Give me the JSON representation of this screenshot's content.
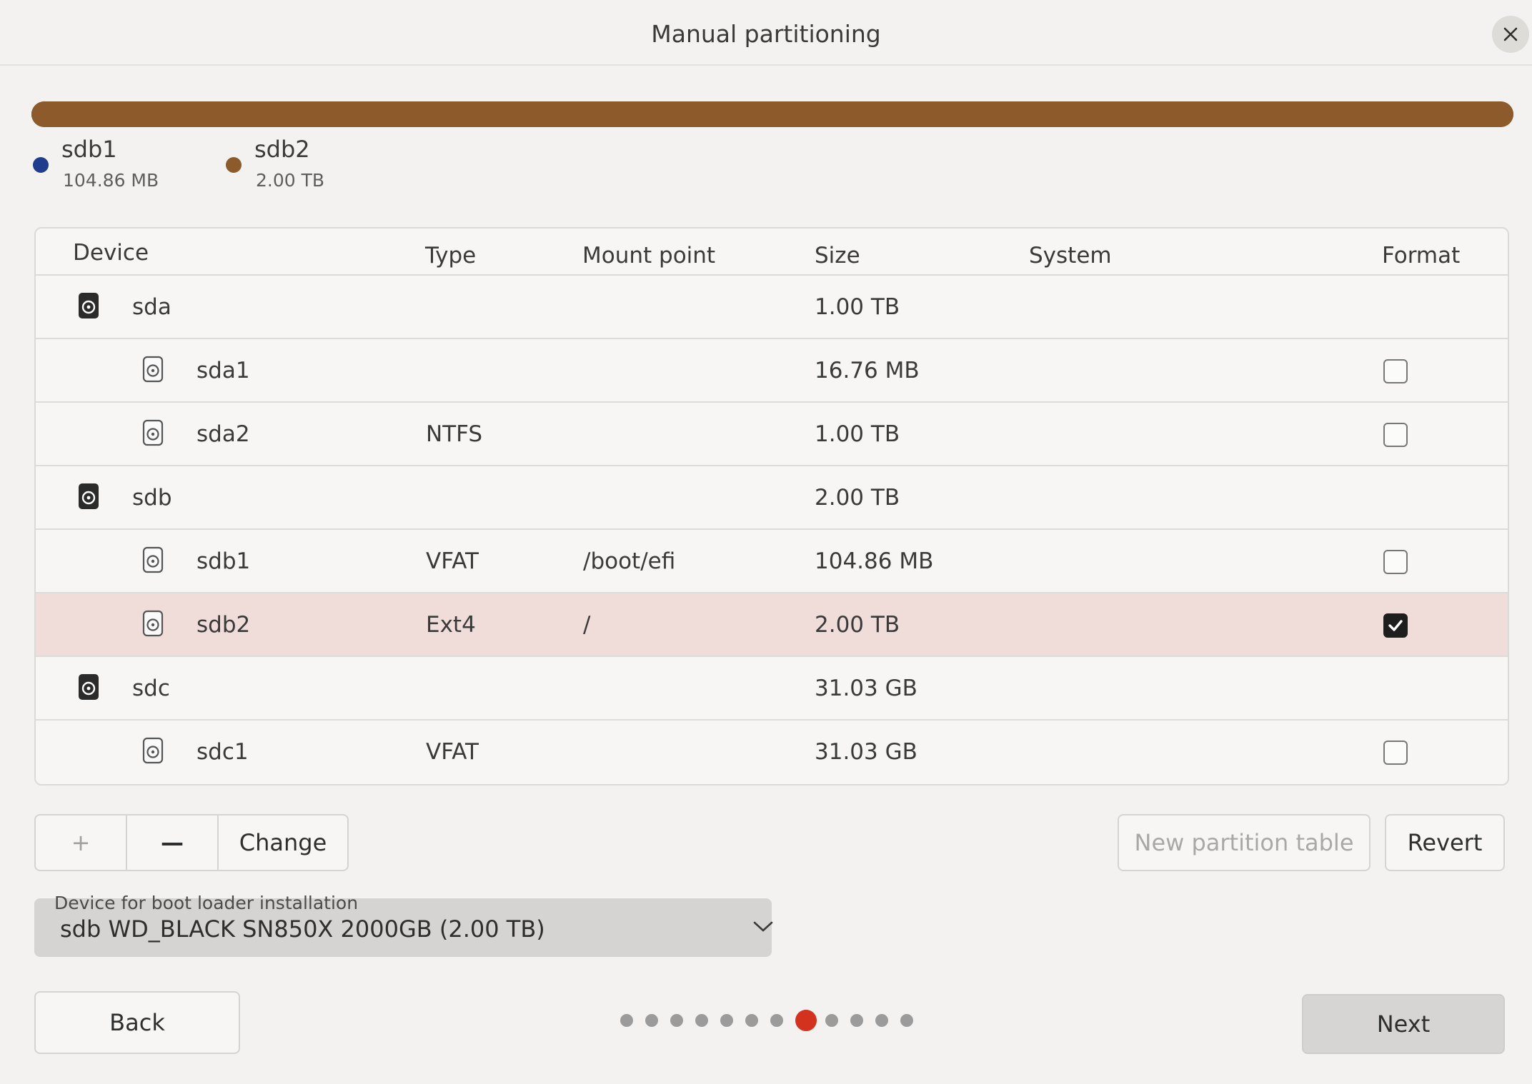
{
  "window": {
    "title": "Manual partitioning",
    "close_icon": "close-icon"
  },
  "usage_bar": {
    "segments": [
      {
        "name": "sdb1",
        "fraction": 0.0001,
        "color": "#203c8c"
      },
      {
        "name": "sdb2",
        "fraction": 0.9999,
        "color": "#8c5a2b"
      }
    ]
  },
  "legend": [
    {
      "name": "sdb1",
      "size": "104.86 MB",
      "color": "#203c8c"
    },
    {
      "name": "sdb2",
      "size": "2.00 TB",
      "color": "#8c5a2b"
    }
  ],
  "table": {
    "headers": {
      "device": "Device",
      "type": "Type",
      "mount": "Mount point",
      "size": "Size",
      "system": "System",
      "format": "Format"
    },
    "rows": [
      {
        "device": "sda",
        "kind": "disk",
        "type": "",
        "mount": "",
        "size": "1.00 TB",
        "system": "",
        "format": null,
        "selected": false
      },
      {
        "device": "sda1",
        "kind": "partition",
        "type": "",
        "mount": "",
        "size": "16.76 MB",
        "system": "",
        "format": false,
        "selected": false
      },
      {
        "device": "sda2",
        "kind": "partition",
        "type": "NTFS",
        "mount": "",
        "size": "1.00 TB",
        "system": "",
        "format": false,
        "selected": false
      },
      {
        "device": "sdb",
        "kind": "disk",
        "type": "",
        "mount": "",
        "size": "2.00 TB",
        "system": "",
        "format": null,
        "selected": false
      },
      {
        "device": "sdb1",
        "kind": "partition",
        "type": "VFAT",
        "mount": "/boot/efi",
        "size": "104.86 MB",
        "system": "",
        "format": false,
        "selected": false
      },
      {
        "device": "sdb2",
        "kind": "partition",
        "type": "Ext4",
        "mount": "/",
        "size": "2.00 TB",
        "system": "",
        "format": true,
        "selected": true
      },
      {
        "device": "sdc",
        "kind": "disk",
        "type": "",
        "mount": "",
        "size": "31.03 GB",
        "system": "",
        "format": null,
        "selected": false
      },
      {
        "device": "sdc1",
        "kind": "partition",
        "type": "VFAT",
        "mount": "",
        "size": "31.03 GB",
        "system": "",
        "format": false,
        "selected": false
      }
    ]
  },
  "toolbar": {
    "add_label": "+",
    "remove_label": "—",
    "change_label": "Change",
    "new_table_label": "New partition table",
    "revert_label": "Revert"
  },
  "bootloader": {
    "label": "Device for boot loader installation",
    "value": "sdb WD_BLACK SN850X 2000GB (2.00 TB)"
  },
  "footer": {
    "back_label": "Back",
    "next_label": "Next",
    "pages_total": 12,
    "current_page": 8
  }
}
